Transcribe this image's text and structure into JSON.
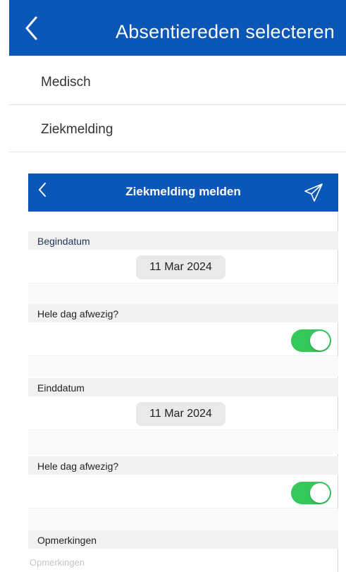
{
  "top_screen": {
    "title": "Absentiereden selecteren",
    "items": [
      {
        "label": "Medisch"
      },
      {
        "label": "Ziekmelding"
      }
    ]
  },
  "form": {
    "title": "Ziekmelding melden",
    "start_date_label": "Begindatum",
    "start_date_value": "11 Mar 2024",
    "all_day_label_1": "Hele dag afwezig?",
    "all_day_1_on": true,
    "end_date_label": "Einddatum",
    "end_date_value": "11 Mar 2024",
    "all_day_label_2": "Hele dag afwezig?",
    "all_day_2_on": true,
    "remarks_label": "Opmerkingen",
    "remarks_placeholder": "Opmerkingen",
    "remarks_value": ""
  },
  "colors": {
    "header_blue": "#0B57B7",
    "toggle_green": "#34C759"
  },
  "icons": {
    "back": "chevron-left-icon",
    "send": "paper-plane-icon"
  }
}
